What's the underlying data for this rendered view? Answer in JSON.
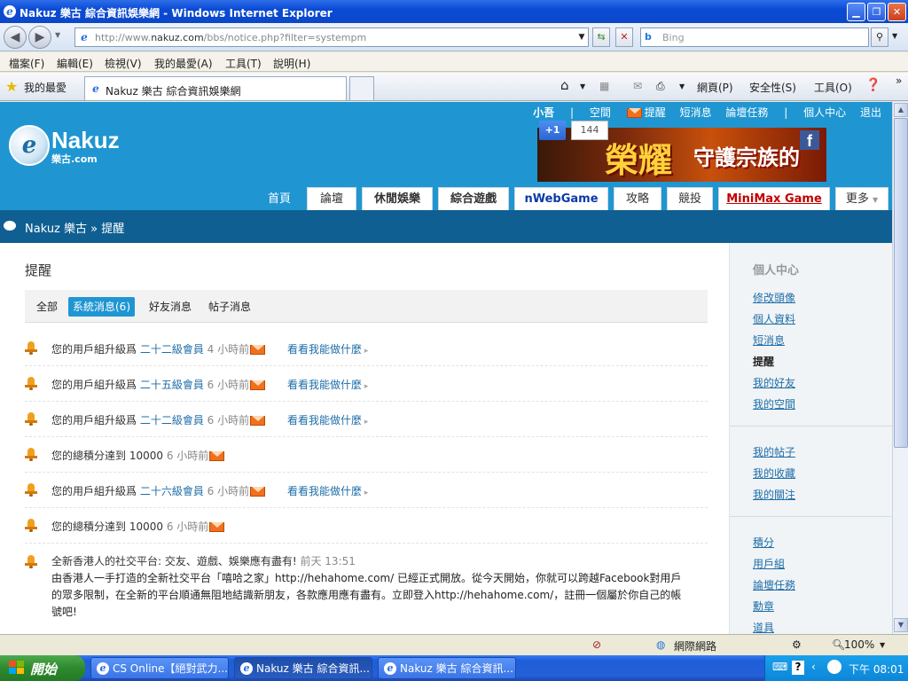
{
  "window": {
    "title": "Nakuz 樂古 綜合資訊娛樂網 - Windows Internet Explorer"
  },
  "browser": {
    "url_prefix": "http://www.",
    "url_domain": "nakuz.com",
    "url_path": "/bbs/notice.php?filter=systempm",
    "search_placeholder": "Bing",
    "menu": [
      "檔案(F)",
      "編輯(E)",
      "檢視(V)",
      "我的最愛(A)",
      "工具(T)",
      "說明(H)"
    ],
    "favorites_label": "我的最愛",
    "tab_title": "Nakuz 樂古 綜合資訊娛樂網",
    "commands": [
      "網頁(P)",
      "安全性(S)",
      "工具(O)"
    ]
  },
  "site": {
    "logo_text": "Nakuz",
    "logo_sub": "樂古.com",
    "top_links": [
      "小吾",
      "|",
      "空間",
      "提醒",
      "短消息",
      "論壇任務",
      "|",
      "個人中心",
      "退出"
    ],
    "gplus_label": "+1",
    "gplus_count": "144",
    "banner_main": "榮耀",
    "banner_sub": "守護宗族的",
    "banner_fb": "f",
    "nav": [
      "首頁",
      "論壇",
      "休閒娛樂",
      "綜合遊戲",
      "nWebGame",
      "攻略",
      "競投",
      "MiniMax Game",
      "更多"
    ],
    "breadcrumb": "Nakuz 樂古 » 提醒"
  },
  "main": {
    "title": "提醒",
    "filters": [
      "全部",
      "系統消息(6)",
      "好友消息",
      "帖子消息"
    ],
    "notices": [
      {
        "pre": "您的用戶組升級爲 ",
        "link": "二十二級會員",
        "time": " 4 小時前",
        "action": "看看我能做什麼"
      },
      {
        "pre": "您的用戶組升級爲 ",
        "link": "二十五級會員",
        "time": " 6 小時前",
        "action": "看看我能做什麼"
      },
      {
        "pre": "您的用戶組升級爲 ",
        "link": "二十二級會員",
        "time": " 6 小時前",
        "action": "看看我能做什麼"
      },
      {
        "pre": "您的總積分達到 10000",
        "link": "",
        "time": " 6 小時前",
        "action": ""
      },
      {
        "pre": "您的用戶組升級爲 ",
        "link": "二十六級會員",
        "time": " 6 小時前",
        "action": "看看我能做什麼"
      },
      {
        "pre": "您的總積分達到 10000",
        "link": "",
        "time": " 6 小時前",
        "action": ""
      }
    ],
    "long_notice": {
      "headline": "全新香港人的社交平台: 交友、遊戲、娛樂應有盡有!",
      "time": " 前天 13:51",
      "body": "由香港人一手打造的全新社交平台「嘻哈之家」http://hehahome.com/ 已經正式開放。從今天開始，你就可以跨越Facebook對用戶的眾多限制，在全新的平台順通無阻地結識新朋友，各款應用應有盡有。立即登入http://hehahome.com/，註冊一個屬於你自己的帳號吧!"
    }
  },
  "sidebar": {
    "heading": "個人中心",
    "group1": [
      "修改頭像",
      "個人資料",
      "短消息",
      "提醒",
      "我的好友",
      "我的空間"
    ],
    "current": "提醒",
    "group2": [
      "我的帖子",
      "我的收藏",
      "我的關注"
    ],
    "group3": [
      "積分",
      "用戶組",
      "論壇任務",
      "勳章",
      "道具"
    ]
  },
  "status": {
    "zone": "網際網路",
    "zoom": "100%"
  },
  "taskbar": {
    "start": "開始",
    "tasks": [
      "CS Online【絕對武力...",
      "Nakuz 樂古 綜合資訊...",
      "Nakuz 樂古 綜合資訊..."
    ],
    "clock": "下午 08:01"
  }
}
